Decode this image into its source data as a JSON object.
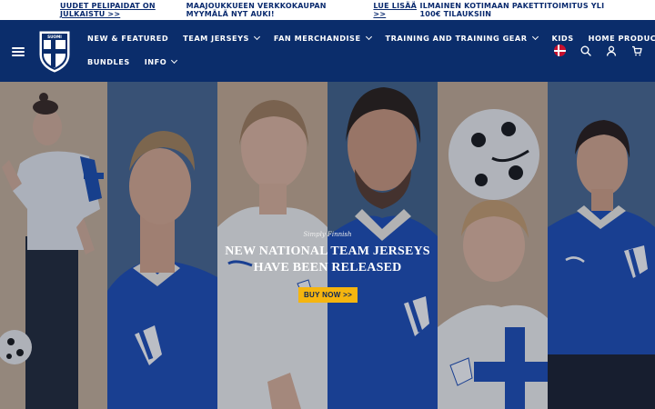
{
  "announcement": {
    "left_link": "UUDET PELIPAIDAT ON JULKAISTU >>",
    "middle_text": "MAAJOUKKUEEN VERKKOKAUPAN MYYMÄLÄ NYT AUKI!",
    "middle_link": "LUE LISÄÄ >>",
    "right_text": "ILMAINEN KOTIMAAN PAKETTITOIMITUS YLI 100€ TILAUKSIIN"
  },
  "logo_text": "SUOMI",
  "nav": {
    "row1": [
      {
        "label": "New & Featured",
        "dropdown": false
      },
      {
        "label": "Team Jerseys",
        "dropdown": true
      },
      {
        "label": "Fan Merchandise",
        "dropdown": true
      },
      {
        "label": "Training and Training Gear",
        "dropdown": true
      },
      {
        "label": "Kids",
        "dropdown": false
      },
      {
        "label": "Home products",
        "dropdown": false
      }
    ],
    "row2": [
      {
        "label": "Bundles",
        "dropdown": false
      },
      {
        "label": "Info",
        "dropdown": true
      }
    ]
  },
  "icons": [
    "hamburger-icon",
    "danish-flag-icon",
    "search-icon",
    "account-icon",
    "cart-icon"
  ],
  "hero": {
    "eyebrow": "Simply Finnish",
    "headline_line1": "NEW NATIONAL TEAM JERSEYS",
    "headline_line2": "HAVE BEEN RELEASED",
    "cta_label": "BUY NOW >>"
  },
  "colors": {
    "brand_navy": "#0b2d6b",
    "cta_yellow": "#f5b50f",
    "jersey_blue": "#1f4fb8",
    "flag_red": "#c8102e"
  }
}
